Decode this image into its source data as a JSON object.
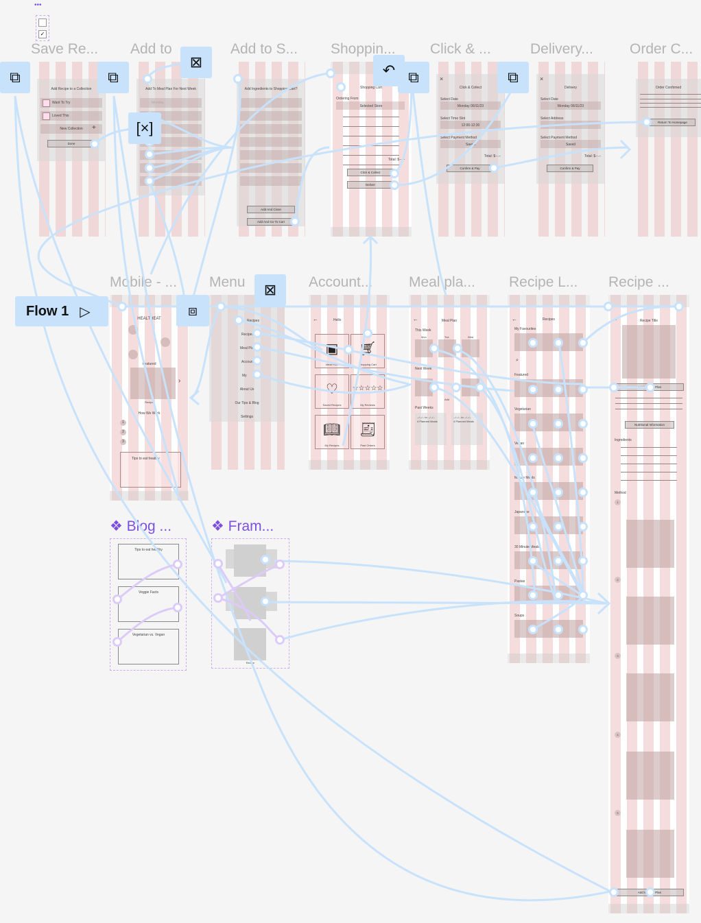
{
  "canvas": {
    "background": "#f5f5f5",
    "connector_color": "#c7e2fa",
    "component_color": "#7c4fe0"
  },
  "selection_dots": "•••",
  "flow": {
    "label": "Flow 1",
    "icon": "play-icon"
  },
  "row1_titles": [
    "Save Re...",
    "Add to",
    "Add to S...",
    "Shoppin...",
    "Click & ...",
    "Delivery...",
    "Order C..."
  ],
  "row2_titles": [
    "Mobile - ...",
    "Menu",
    "Account...",
    "Meal pla...",
    "Recipe L...",
    "Recipe ..."
  ],
  "save_recipe": {
    "heading": "Add Recipe to a Collection",
    "options": [
      "Want To Try",
      "Loved This"
    ],
    "new_collection": "New Collection",
    "done": "Done"
  },
  "add_meal_plan": {
    "heading": "Add To Meal Plan For Next Week",
    "first_day": "Monday"
  },
  "add_shopping": {
    "heading": "Add Ingredients to Shopping Cart?",
    "add_close": "Add And Close",
    "add_cart": "Add And Go To Cart"
  },
  "shopping_cart": {
    "heading": "Shopping Cart",
    "ordering_from": "Ordering From",
    "store": "Selected Store",
    "total": "Total: $--.--",
    "click_collect": "Click & Collect",
    "deliver": "Deliver"
  },
  "click_collect": {
    "heading": "Click & Collect",
    "select_date": "Select Date",
    "date": "Monday 06/11/23",
    "select_slot": "Select Time Slot",
    "slot": "12:00-12:30",
    "select_payment": "Select Payment Method",
    "payment": "Saved",
    "total": "Total: $--.--",
    "confirm": "Confirm & Pay"
  },
  "delivery": {
    "heading": "Delivery",
    "select_date": "Select Date",
    "date": "Monday 06/11/23",
    "select_address": "Select Address",
    "select_payment": "Select Payment Method",
    "payment": "Saved",
    "total": "Total: $--.--",
    "confirm": "Confirm & Pay"
  },
  "order_confirmed": {
    "heading": "Order Confirmed",
    "return": "Return To Homepage"
  },
  "home": {
    "brand": "HEALTHEAT",
    "featured": "Featured",
    "recipe": "Recipe",
    "how": "How We Work",
    "steps": [
      "1",
      "2",
      "3"
    ],
    "tips": "Tips to eat healthy"
  },
  "menu": {
    "items": [
      "Recipes",
      "Recipes",
      "Meal Plan",
      "Account",
      "My",
      "About Us",
      "Our Tips & Blog",
      "Settings"
    ]
  },
  "account": {
    "hello": "Hello",
    "cards": [
      {
        "label": "Meal Plan",
        "icon": "calendar-icon"
      },
      {
        "label": "Shopping Cart",
        "icon": "cart-icon"
      },
      {
        "label": "Saved Recipes",
        "icon": "heart-icon"
      },
      {
        "label": "My Reviews",
        "icon": "stars-icon"
      },
      {
        "label": "My Recipes",
        "icon": "book-icon"
      },
      {
        "label": "Past Orders",
        "icon": "receipt-icon"
      }
    ]
  },
  "meal_plan": {
    "heading": "Meal Plan",
    "this_week": "This Week",
    "next_week": "Next Week",
    "days": [
      "Mon",
      "Tue",
      "Wed"
    ],
    "add": "Add",
    "past": "Past Weeks",
    "past_range": "--/--/-- to --/--/--",
    "past_count": "4 Planned Meals"
  },
  "recipes": {
    "heading": "Recipes",
    "sections": [
      "My Favourites",
      "Featured",
      "Vegetarian",
      "Vegan",
      "Minute Meals",
      "Japanese",
      "30 Minute Meals",
      "Pastas",
      "Soups"
    ]
  },
  "recipe": {
    "title": "Recipe Title",
    "add_meal_plan": "Add to Meal Plan",
    "nutrition": "Nutritional Information",
    "ingredients": "Ingredients",
    "method": "Method",
    "steps": [
      "1",
      "2",
      "3",
      "4",
      "5"
    ]
  },
  "blog": {
    "title": "Blog ...",
    "items": [
      "Tips to eat healthy",
      "Veggie Facts",
      "Vegetarian vs. Vegan"
    ]
  },
  "frame_comp": {
    "title": "Fram...",
    "label": "Recipe"
  }
}
